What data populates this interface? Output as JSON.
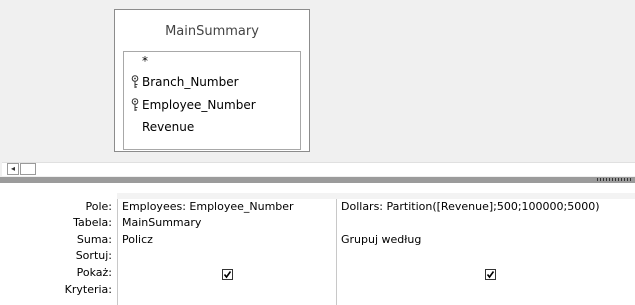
{
  "table": {
    "name": "MainSummary",
    "fields": [
      {
        "label": "*",
        "is_key": false
      },
      {
        "label": "Branch_Number",
        "is_key": true
      },
      {
        "label": "Employee_Number",
        "is_key": true
      },
      {
        "label": "Revenue",
        "is_key": false
      }
    ]
  },
  "grid": {
    "row_labels": {
      "field": "Pole:",
      "table": "Tabela:",
      "total": "Suma:",
      "sort": "Sortuj:",
      "show": "Pokaż:",
      "criteria": "Kryteria:"
    },
    "columns": [
      {
        "field": "Employees: Employee_Number",
        "table": "MainSummary",
        "total": "Policz",
        "sort": "",
        "show": true
      },
      {
        "field": "Dollars: Partition([Revenue];500;100000;5000)",
        "table": "",
        "total": "Grupuj według",
        "sort": "",
        "show": true
      }
    ]
  },
  "scroll": {
    "left_arrow": "◂"
  }
}
